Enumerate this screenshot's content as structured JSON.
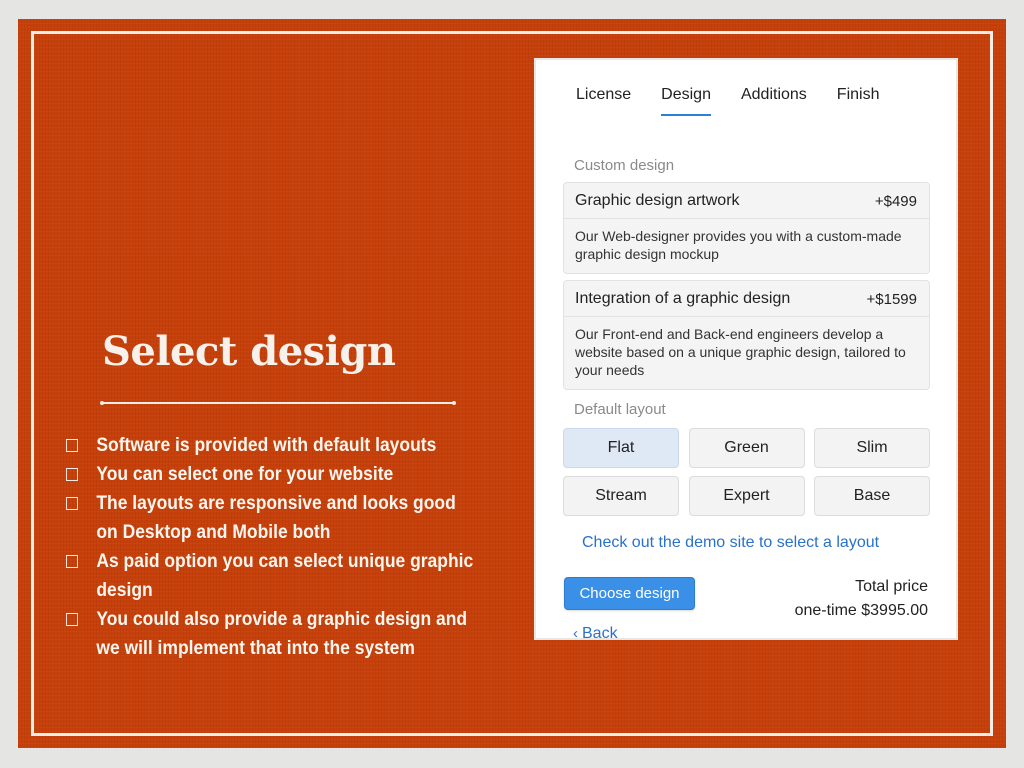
{
  "slide": {
    "title": "Select design",
    "bullets": [
      "Software is provided with default layouts",
      "You can select one for your website",
      "The layouts are responsive and looks good on Desktop and Mobile both",
      "As paid option you can select unique graphic design",
      "You could also provide a graphic design and we will implement that into the system"
    ]
  },
  "panel": {
    "tabs": [
      {
        "label": "License",
        "active": false
      },
      {
        "label": "Design",
        "active": true
      },
      {
        "label": "Additions",
        "active": false
      },
      {
        "label": "Finish",
        "active": false
      }
    ],
    "custom_design_label": "Custom design",
    "cards": [
      {
        "title": "Graphic design artwork",
        "price": "+$499",
        "description": "Our Web-designer provides you with a custom-made graphic design mockup"
      },
      {
        "title": "Integration of a graphic design",
        "price": "+$1599",
        "description": "Our Front-end and Back-end engineers develop a website based on a unique graphic design, tailored to your needs"
      }
    ],
    "default_layout_label": "Default layout",
    "layouts": [
      {
        "label": "Flat",
        "selected": true
      },
      {
        "label": "Green",
        "selected": false
      },
      {
        "label": "Slim",
        "selected": false
      },
      {
        "label": "Stream",
        "selected": false
      },
      {
        "label": "Expert",
        "selected": false
      },
      {
        "label": "Base",
        "selected": false
      }
    ],
    "demo_link": "Check out the demo site to select a layout",
    "choose_button": "Choose design",
    "total_label": "Total price",
    "total_value": "one-time $3995.00",
    "back_icon": "chevron-left-icon",
    "back_link": "Back"
  },
  "colors": {
    "slide_background": "#c5400a",
    "accent_blue": "#3a8fe6",
    "link_blue": "#2a71c9",
    "selected_layout": "#dfe9f6"
  }
}
